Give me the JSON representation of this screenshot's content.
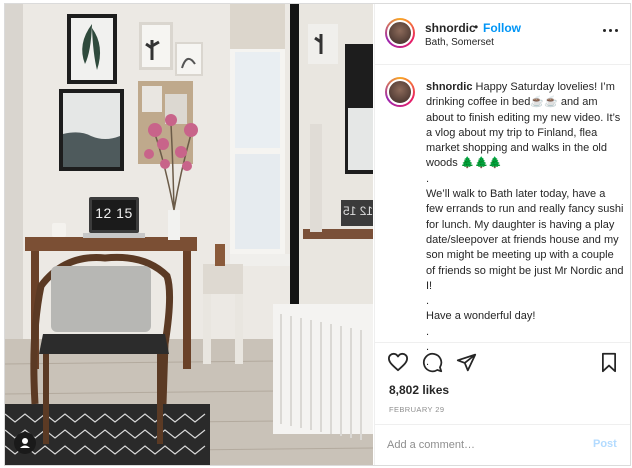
{
  "post": {
    "username": "shnordic",
    "separator": "•",
    "follow_label": "Follow",
    "location": "Bath, Somerset",
    "caption": {
      "username": "shnordic",
      "lines": [
        " Happy Saturday lovelies! I’m drinking coffee in bed☕☕ and am about to finish editing my new video. It’s a vlog about my trip to Finland, flea market shopping and walks in the old woods 🌲🌲🌲",
        ".",
        "We’ll walk to Bath later today, have a few errands to run and really fancy sushi for lunch. My daughter is having a play date/sleepover at friends house and my son might be meeting up with a couple of friends so might be just Mr Nordic and I!",
        ".",
        "Have a wonderful day!",
        ".",
        ".",
        "."
      ]
    },
    "likes": "8,802 likes",
    "date": "FEBRUARY 29",
    "comment_placeholder": "Add a comment…",
    "post_label": "Post"
  },
  "photo": {
    "clock_text": "12 15",
    "mirror_clock_text": "12 15"
  },
  "icons": {
    "like": "heart-icon",
    "comment": "comment-bubble-icon",
    "share": "paper-plane-icon",
    "save": "bookmark-icon",
    "more": "more-options-icon",
    "tag": "user-tag-icon"
  },
  "colors": {
    "accent": "#0095f6",
    "post_disabled": "#b3dbff",
    "text": "#262626",
    "muted": "#8e8e8e",
    "divider": "#efefef"
  }
}
